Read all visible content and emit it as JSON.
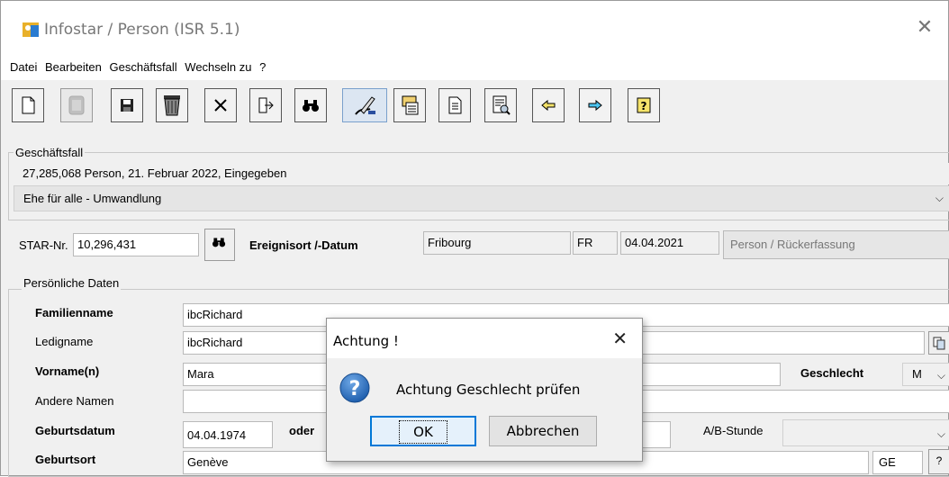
{
  "window": {
    "title": "Infostar / Person (ISR 5.1)",
    "close_symbol": "✕"
  },
  "menu": [
    "Datei",
    "Bearbeiten",
    "Geschäftsfall",
    "Wechseln zu",
    "?"
  ],
  "toolbar": {
    "icons": [
      "new-document-icon",
      "delete-disabled-icon",
      "save-icon",
      "trash-icon",
      "cancel-icon",
      "export-icon",
      "search-binoculars-icon",
      "edit-sign-icon",
      "clipboard-icon",
      "document-icon",
      "print-preview-icon",
      "arrow-left-icon",
      "arrow-right-icon",
      "help-icon"
    ]
  },
  "geschaeftsfall": {
    "label": "Geschäftsfall",
    "info": "27,285,068  Person, 21. Februar 2022, Eingegeben",
    "selected": "Ehe für alle - Umwandlung"
  },
  "star": {
    "label": "STAR-Nr.",
    "value": "10,296,431",
    "ereignisort_label": "Ereignisort /-Datum",
    "ort": "Fribourg",
    "kanton": "FR",
    "datum": "04.04.2021",
    "typ": "Person / Rückerfassung"
  },
  "personal": {
    "section_label": "Persönliche Daten",
    "familienname_label": "Familienname",
    "familienname": "ibcRichard",
    "ledigname_label": "Ledigname",
    "ledigname": "ibcRichard",
    "vorname_label": "Vorname(n)",
    "vorname": "Mara",
    "geschlecht_label": "Geschlecht",
    "geschlecht": "M",
    "andere_namen_label": "Andere Namen",
    "andere_namen": "",
    "geburtsdatum_label": "Geburtsdatum",
    "geburtsdatum": "04.04.1974",
    "oder_label": "oder",
    "ab_stunde_label": "A/B-Stunde",
    "geburtsort_label": "Geburtsort",
    "geburtsort": "Genève",
    "geburtsort_kanton": "GE",
    "help_label": "?"
  },
  "dialog": {
    "title": "Achtung !",
    "close_symbol": "✕",
    "message": "Achtung Geschlecht prüfen",
    "ok_label": "OK",
    "cancel_label": "Abbrechen",
    "icon": "question-icon"
  },
  "colors": {
    "accent": "#0078d7",
    "question_icon": "#1f5fae"
  }
}
